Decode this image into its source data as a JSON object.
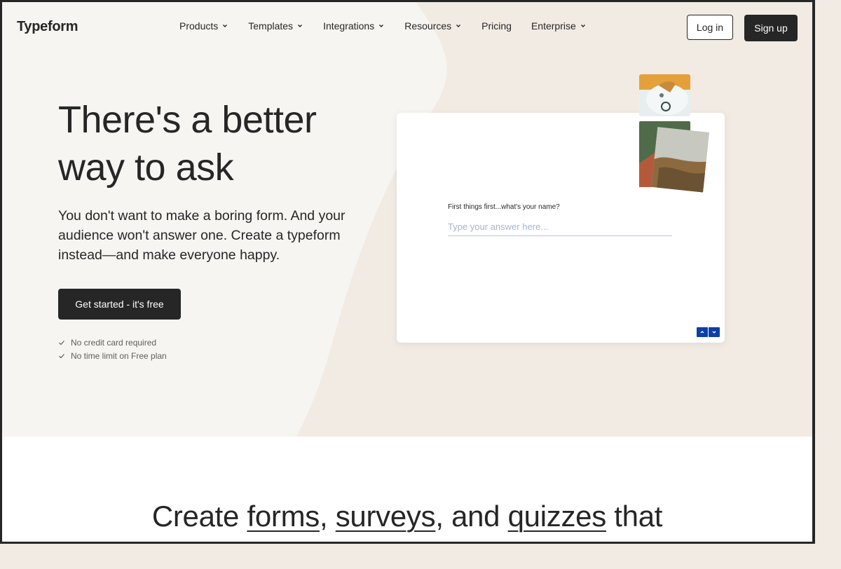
{
  "header": {
    "logo": "Typeform",
    "menu": [
      {
        "label": "Products",
        "dropdown": true
      },
      {
        "label": "Templates",
        "dropdown": true
      },
      {
        "label": "Integrations",
        "dropdown": true
      },
      {
        "label": "Resources",
        "dropdown": true
      },
      {
        "label": "Pricing",
        "dropdown": false
      },
      {
        "label": "Enterprise",
        "dropdown": true
      }
    ],
    "login_label": "Log in",
    "signup_label": "Sign up"
  },
  "hero": {
    "title": "There's a better way to ask",
    "subtitle": "You don't want to make a boring form. And your audience won't answer one. Create a typeform instead—and make everyone happy.",
    "cta_label": "Get started - it's free",
    "checks": [
      "No credit card required",
      "No time limit on Free plan"
    ]
  },
  "preview": {
    "question": "First things first...what's your name?",
    "answer_placeholder": "Type your answer here...",
    "nav_icons": [
      "chevron-up-icon",
      "chevron-down-icon"
    ]
  },
  "lower": {
    "title_parts": [
      "Create ",
      "forms",
      ", ",
      "surveys",
      ", and ",
      "quizzes",
      " that"
    ]
  },
  "colors": {
    "ink": "#262627",
    "page_bg": "#f7f5f2",
    "shape_bg": "#f2ebe4",
    "accent_blue": "#0c3fa8"
  }
}
